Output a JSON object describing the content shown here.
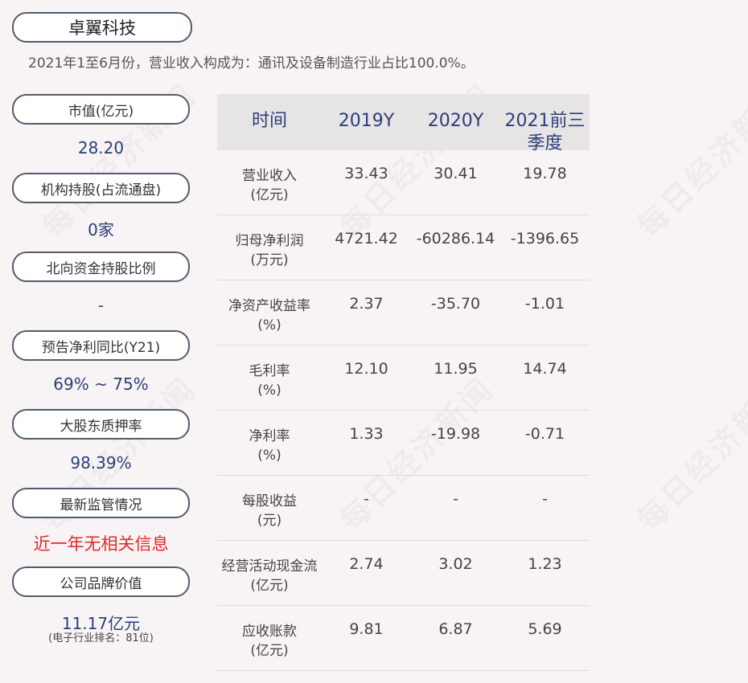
{
  "company": "卓翼科技",
  "subtitle": "2021年1至6月份，营业收入构成为：通讯及设备制造行业占比100.0%。",
  "watermark": "每日经济新闻",
  "metrics": [
    {
      "label": "市值(亿元)",
      "value": "28.20"
    },
    {
      "label": "机构持股(占流通盘)",
      "value": "0家"
    },
    {
      "label": "北向资金持股比例",
      "value": "-"
    },
    {
      "label": "预告净利同比(Y21)",
      "value": "69% ~ 75%"
    },
    {
      "label": "大股东质押率",
      "value": "98.39%"
    },
    {
      "label": "最新监管情况",
      "value": "近一年无相关信息"
    },
    {
      "label": "公司品牌价值",
      "value": "11.17亿元",
      "note": "(电子行业排名：81位)"
    }
  ],
  "table": {
    "headers": [
      "时间",
      "2019Y",
      "2020Y",
      "2021前三季度"
    ],
    "rows": [
      {
        "label": "营业收入",
        "unit": "(亿元)",
        "values": [
          "33.43",
          "30.41",
          "19.78"
        ]
      },
      {
        "label": "归母净利润",
        "unit": "(万元)",
        "values": [
          "4721.42",
          "-60286.14",
          "-1396.65"
        ]
      },
      {
        "label": "净资产收益率",
        "unit": "(%)",
        "values": [
          "2.37",
          "-35.70",
          "-1.01"
        ]
      },
      {
        "label": "毛利率",
        "unit": "(%)",
        "values": [
          "12.10",
          "11.95",
          "14.74"
        ]
      },
      {
        "label": "净利率",
        "unit": "(%)",
        "values": [
          "1.33",
          "-19.98",
          "-0.71"
        ]
      },
      {
        "label": "每股收益",
        "unit": "(元)",
        "values": [
          "-",
          "-",
          "-"
        ]
      },
      {
        "label": "经营活动现金流",
        "unit": "(亿元)",
        "values": [
          "2.74",
          "3.02",
          "1.23"
        ]
      },
      {
        "label": "应收账款",
        "unit": "(亿元)",
        "values": [
          "9.81",
          "6.87",
          "5.69"
        ]
      }
    ]
  }
}
